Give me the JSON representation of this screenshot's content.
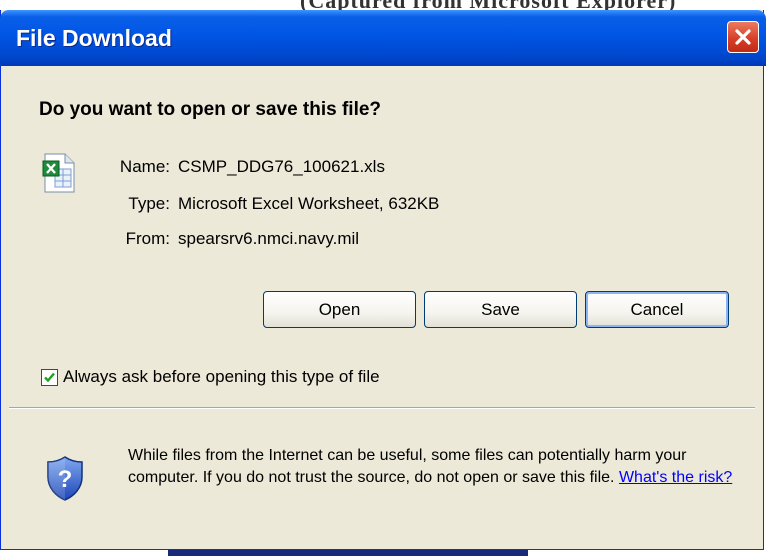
{
  "top_fragment": "(Captured from Microsoft Explorer)",
  "window": {
    "title": "File Download"
  },
  "heading": "Do you want to open or save this file?",
  "file": {
    "icon": "excel-file-icon",
    "name_label": "Name:",
    "name_value": "CSMP_DDG76_100621.xls",
    "type_label": "Type:",
    "type_value": "Microsoft Excel Worksheet, 632KB",
    "from_label": "From:",
    "from_value": "spearsrv6.nmci.navy.mil"
  },
  "buttons": {
    "open": "Open",
    "save": "Save",
    "cancel": "Cancel"
  },
  "checkbox": {
    "label": "Always ask before opening this type of file",
    "checked": true
  },
  "warning": {
    "text": "While files from the Internet can be useful, some files can potentially harm your computer. If you do not trust the source, do not open or save this file.",
    "link": "What's the risk?"
  },
  "colors": {
    "titlebar": "#0055E5",
    "dialog_bg": "#ECE9D8",
    "close_button": "#D6402A",
    "link": "#0000FF"
  }
}
